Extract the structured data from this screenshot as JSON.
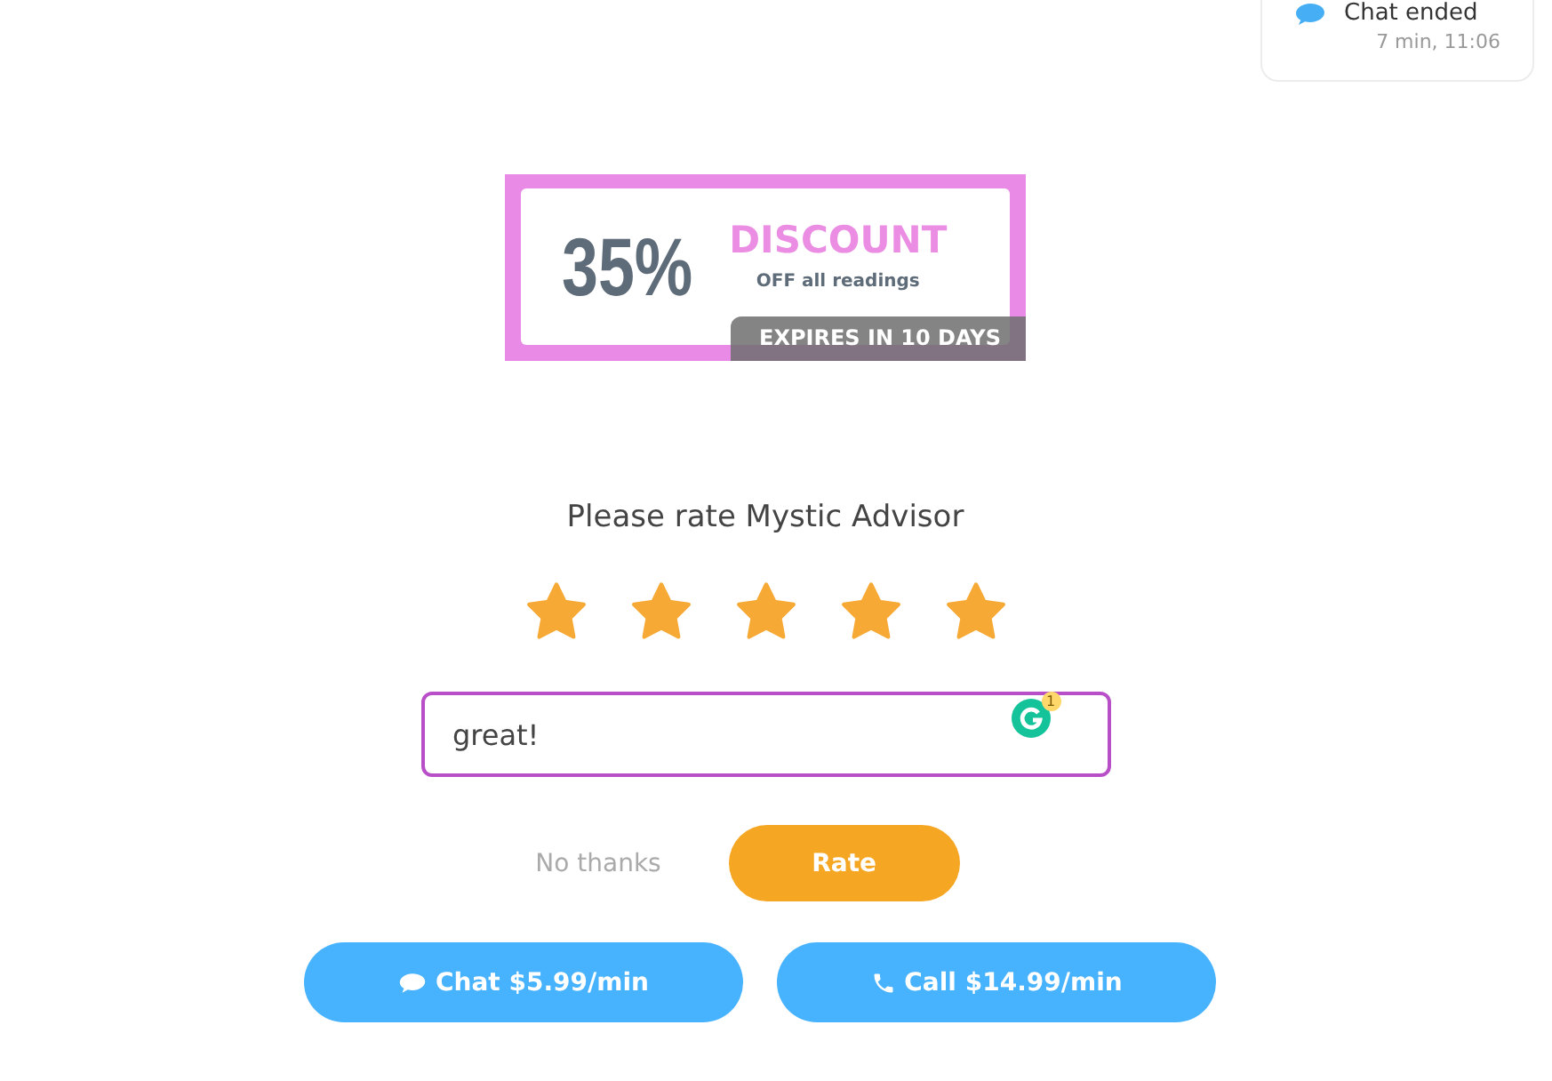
{
  "chat_status": {
    "title": "Chat ended",
    "time": "7 min, 11:06"
  },
  "coupon": {
    "amount": "35%",
    "headline": "DISCOUNT",
    "subline": "OFF all readings",
    "expiry": "EXPIRES IN 10 DAYS"
  },
  "rating": {
    "prompt": "Please rate Mystic Advisor",
    "stars": 5
  },
  "review": {
    "value": "great!",
    "assistant_badge": "1"
  },
  "actions": [
    {
      "label": "No thanks",
      "kind": "link"
    },
    {
      "label": "Rate",
      "kind": "primary"
    }
  ],
  "contact_buttons": [
    {
      "label": "Chat $5.99/min",
      "kind": "chat"
    },
    {
      "label": "Call $14.99/min",
      "kind": "call"
    }
  ]
}
